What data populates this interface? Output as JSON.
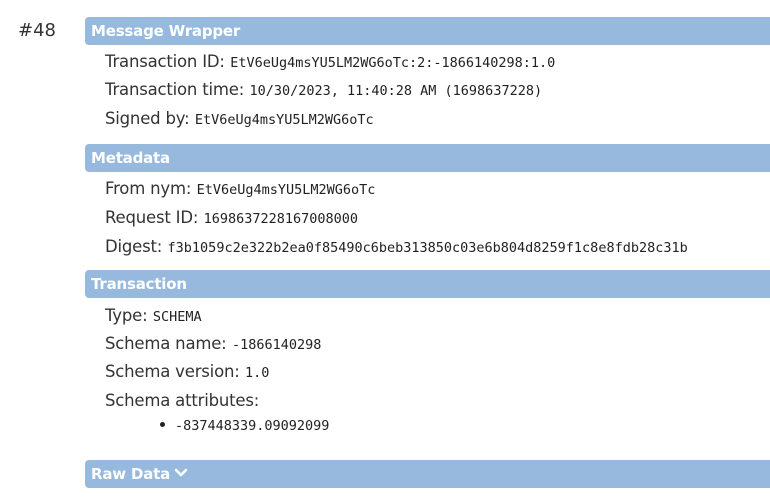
{
  "transaction_number": "#48",
  "sections": {
    "message_wrapper": {
      "title": "Message Wrapper",
      "transaction_id_label": "Transaction ID:",
      "transaction_id_value": "EtV6eUg4msYU5LM2WG6oTc:2:-1866140298:1.0",
      "transaction_time_label": "Transaction time:",
      "transaction_time_value": "10/30/2023, 11:40:28 AM (1698637228)",
      "signed_by_label": "Signed by:",
      "signed_by_value": "EtV6eUg4msYU5LM2WG6oTc"
    },
    "metadata": {
      "title": "Metadata",
      "from_nym_label": "From nym:",
      "from_nym_value": "EtV6eUg4msYU5LM2WG6oTc",
      "request_id_label": "Request ID:",
      "request_id_value": "1698637228167008000",
      "digest_label": "Digest:",
      "digest_value": "f3b1059c2e322b2ea0f85490c6beb313850c03e6b804d8259f1c8e8fdb28c31b"
    },
    "transaction": {
      "title": "Transaction",
      "type_label": "Type:",
      "type_value": "SCHEMA",
      "schema_name_label": "Schema name:",
      "schema_name_value": "-1866140298",
      "schema_version_label": "Schema version:",
      "schema_version_value": "1.0",
      "schema_attributes_label": "Schema attributes:",
      "schema_attributes": [
        "-837448339.09092099"
      ]
    },
    "raw_data": {
      "title": "Raw Data",
      "icon": "chevron-down-icon"
    }
  },
  "colors": {
    "header_background": "#96b9dd",
    "header_text": "#ffffff"
  }
}
